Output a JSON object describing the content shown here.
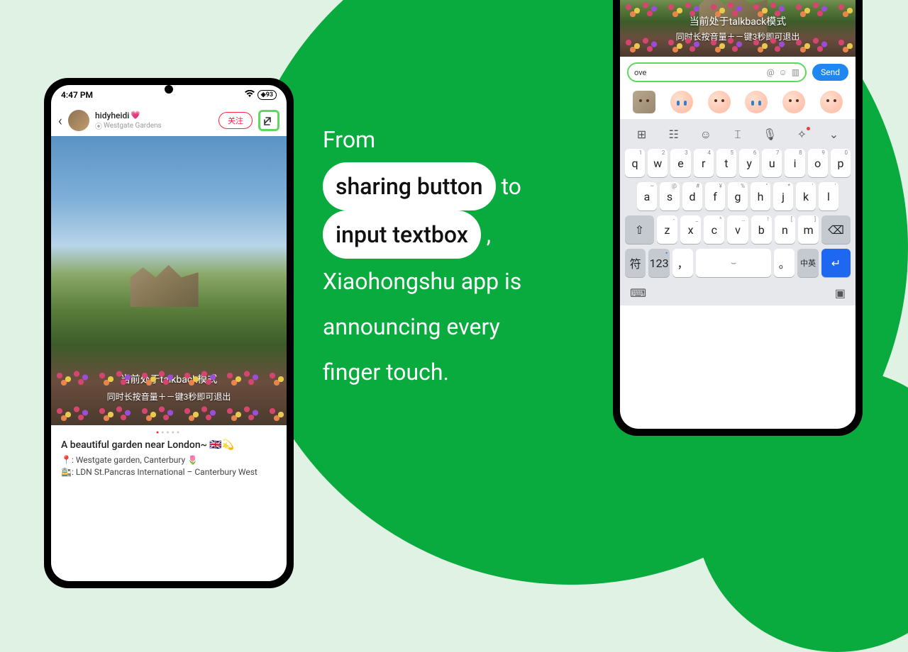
{
  "center": {
    "line1": "From",
    "pill1": "sharing button",
    "word_to": "to",
    "pill2": "input textbox",
    "comma": ",",
    "line3": "Xiaohongshu app is",
    "line4": "announcing every",
    "line5": "finger touch."
  },
  "phoneLeft": {
    "status": {
      "time": "4:47 PM",
      "battery": "93"
    },
    "header": {
      "username": "hidyheidi",
      "location": "Westgate Gardens",
      "follow": "关注"
    },
    "overlay1": "当前处于talkback模式",
    "overlay2": "同时长按音量＋－键3秒即可退出",
    "post": {
      "title": "A beautiful garden near London~ 🇬🇧💫",
      "line1": "📍: Westgate garden, Canterbury 🌷",
      "line2": "🚉: LDN St.Pancras International – Canterbury West"
    }
  },
  "phoneRight": {
    "overlay1": "当前处于talkback模式",
    "overlay2": "同时长按音量＋－键3秒即可退出",
    "input": {
      "value": "ove",
      "send": "Send"
    },
    "keyboard": {
      "row1": [
        {
          "k": "q",
          "s": "1"
        },
        {
          "k": "w",
          "s": "2"
        },
        {
          "k": "e",
          "s": "3"
        },
        {
          "k": "r",
          "s": "4"
        },
        {
          "k": "t",
          "s": "5"
        },
        {
          "k": "y",
          "s": "6"
        },
        {
          "k": "u",
          "s": "7"
        },
        {
          "k": "i",
          "s": "8"
        },
        {
          "k": "o",
          "s": "9"
        },
        {
          "k": "p",
          "s": "0"
        }
      ],
      "row2": [
        {
          "k": "a",
          "s": "~"
        },
        {
          "k": "s",
          "s": "@"
        },
        {
          "k": "d",
          "s": "#"
        },
        {
          "k": "f",
          "s": "¥"
        },
        {
          "k": "g",
          "s": "%"
        },
        {
          "k": "h",
          "s": "\""
        },
        {
          "k": "j",
          "s": "*"
        },
        {
          "k": "k",
          "s": "'"
        },
        {
          "k": "l",
          "s": "'"
        }
      ],
      "row3": [
        {
          "k": "z",
          "s": "-"
        },
        {
          "k": "x",
          "s": "_"
        },
        {
          "k": "c",
          "s": "^"
        },
        {
          "k": "v",
          "s": "…"
        },
        {
          "k": "b",
          "s": "!"
        },
        {
          "k": "n",
          "s": "["
        },
        {
          "k": "m",
          "s": "]"
        }
      ],
      "shift": "⇧",
      "backspace": "⌫",
      "sym": "符",
      "num": "123",
      "comma": "，",
      "period": "。",
      "lang": "中英",
      "enter": "↵"
    }
  }
}
